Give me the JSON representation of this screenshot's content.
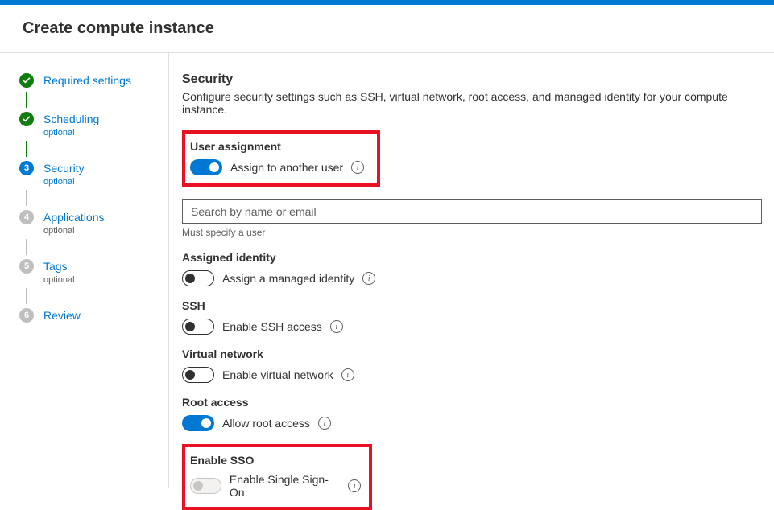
{
  "page_title": "Create compute instance",
  "steps": {
    "required": {
      "label": "Required settings"
    },
    "scheduling": {
      "label": "Scheduling",
      "sub": "optional"
    },
    "security": {
      "label": "Security",
      "sub": "optional",
      "num": "3"
    },
    "applications": {
      "label": "Applications",
      "sub": "optional",
      "num": "4"
    },
    "tags": {
      "label": "Tags",
      "sub": "optional",
      "num": "5"
    },
    "review": {
      "label": "Review",
      "num": "6"
    }
  },
  "main": {
    "heading": "Security",
    "desc": "Configure security settings such as SSH, virtual network, root access, and managed identity for your compute instance.",
    "user_assignment": {
      "heading": "User assignment",
      "toggle_label": "Assign to another user",
      "search_placeholder": "Search by name or email",
      "hint": "Must specify a user"
    },
    "assigned_identity": {
      "heading": "Assigned identity",
      "toggle_label": "Assign a managed identity"
    },
    "ssh": {
      "heading": "SSH",
      "toggle_label": "Enable SSH access"
    },
    "vnet": {
      "heading": "Virtual network",
      "toggle_label": "Enable virtual network"
    },
    "root": {
      "heading": "Root access",
      "toggle_label": "Allow root access"
    },
    "sso": {
      "heading": "Enable SSO",
      "toggle_label": "Enable Single Sign-On"
    }
  }
}
